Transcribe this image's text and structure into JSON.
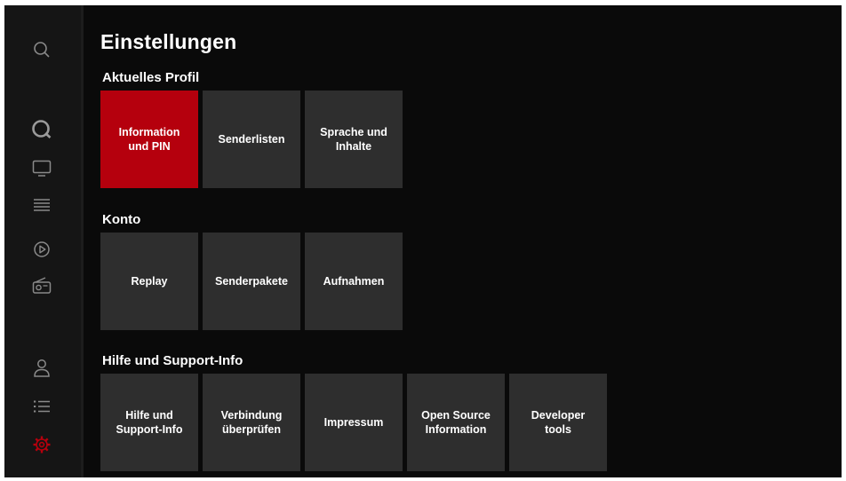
{
  "page_title": "Einstellungen",
  "colors": {
    "background": "#0a0a0a",
    "sidebar": "#151515",
    "tile": "#2e2e2e",
    "active_tile": "#b5000d",
    "active_icon": "#b5000d",
    "icon": "#8a8a8a"
  },
  "sidebar": {
    "items": [
      {
        "icon": "search-icon",
        "active": false
      },
      {
        "icon": "home-logo-icon",
        "active": false
      },
      {
        "icon": "tv-icon",
        "active": false
      },
      {
        "icon": "guide-icon",
        "active": false
      },
      {
        "icon": "play-circle-icon",
        "active": false
      },
      {
        "icon": "radio-icon",
        "active": false
      },
      {
        "icon": "profile-icon",
        "active": false
      },
      {
        "icon": "list-icon",
        "active": false
      },
      {
        "icon": "settings-gear-icon",
        "active": true
      }
    ]
  },
  "sections": [
    {
      "title": "Aktuelles Profil",
      "tiles": [
        {
          "label": "Information\nund PIN",
          "active": true
        },
        {
          "label": "Senderlisten",
          "active": false
        },
        {
          "label": "Sprache und\nInhalte",
          "active": false
        }
      ]
    },
    {
      "title": "Konto",
      "tiles": [
        {
          "label": "Replay",
          "active": false
        },
        {
          "label": "Senderpakete",
          "active": false
        },
        {
          "label": "Aufnahmen",
          "active": false
        }
      ]
    },
    {
      "title": "Hilfe und Support-Info",
      "tiles": [
        {
          "label": "Hilfe und\nSupport-Info",
          "active": false
        },
        {
          "label": "Verbindung\nüberprüfen",
          "active": false
        },
        {
          "label": "Impressum",
          "active": false
        },
        {
          "label": "Open Source\nInformation",
          "active": false
        },
        {
          "label": "Developer\ntools",
          "active": false
        }
      ]
    }
  ]
}
